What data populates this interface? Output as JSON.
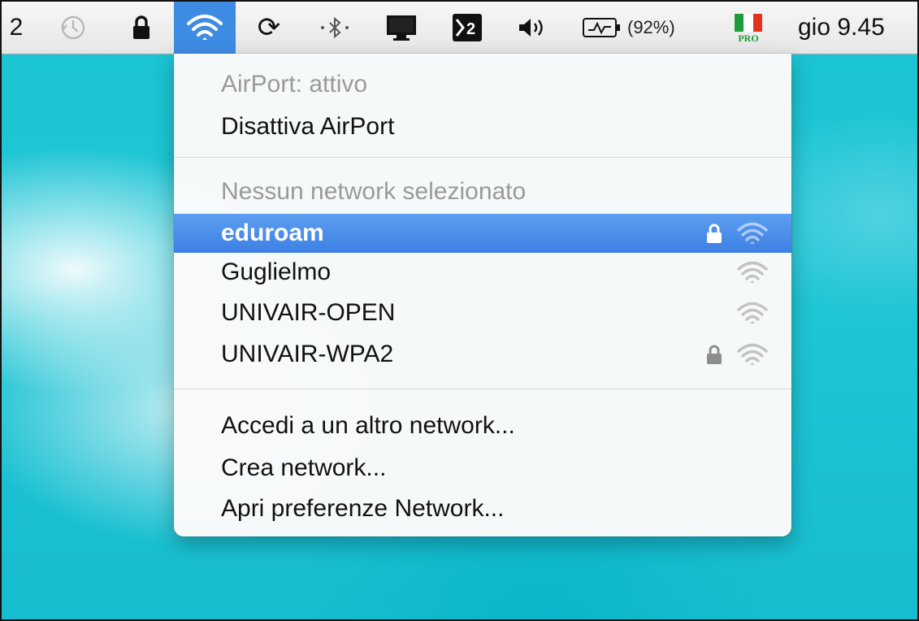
{
  "menubar": {
    "space_number": "2",
    "battery_percent": "(92%)",
    "flag_badge": "PRO",
    "clock": "gio 9.45"
  },
  "menu": {
    "airport_status": "AirPort: attivo",
    "disable_airport": "Disattiva AirPort",
    "no_network": "Nessun network selezionato",
    "networks": [
      {
        "name": "eduroam",
        "secured": true,
        "selected": true
      },
      {
        "name": "Guglielmo",
        "secured": false,
        "selected": false
      },
      {
        "name": "UNIVAIR-OPEN",
        "secured": false,
        "selected": false
      },
      {
        "name": "UNIVAIR-WPA2",
        "secured": true,
        "selected": false
      }
    ],
    "join_other": "Accedi a un altro network...",
    "create_network": "Crea network...",
    "open_preferences": "Apri preferenze Network..."
  },
  "colors": {
    "highlight": "#3e8be3",
    "wallpaper": "#1ec4d4",
    "flag_green": "#1e9c3a",
    "flag_red": "#e2341f"
  }
}
